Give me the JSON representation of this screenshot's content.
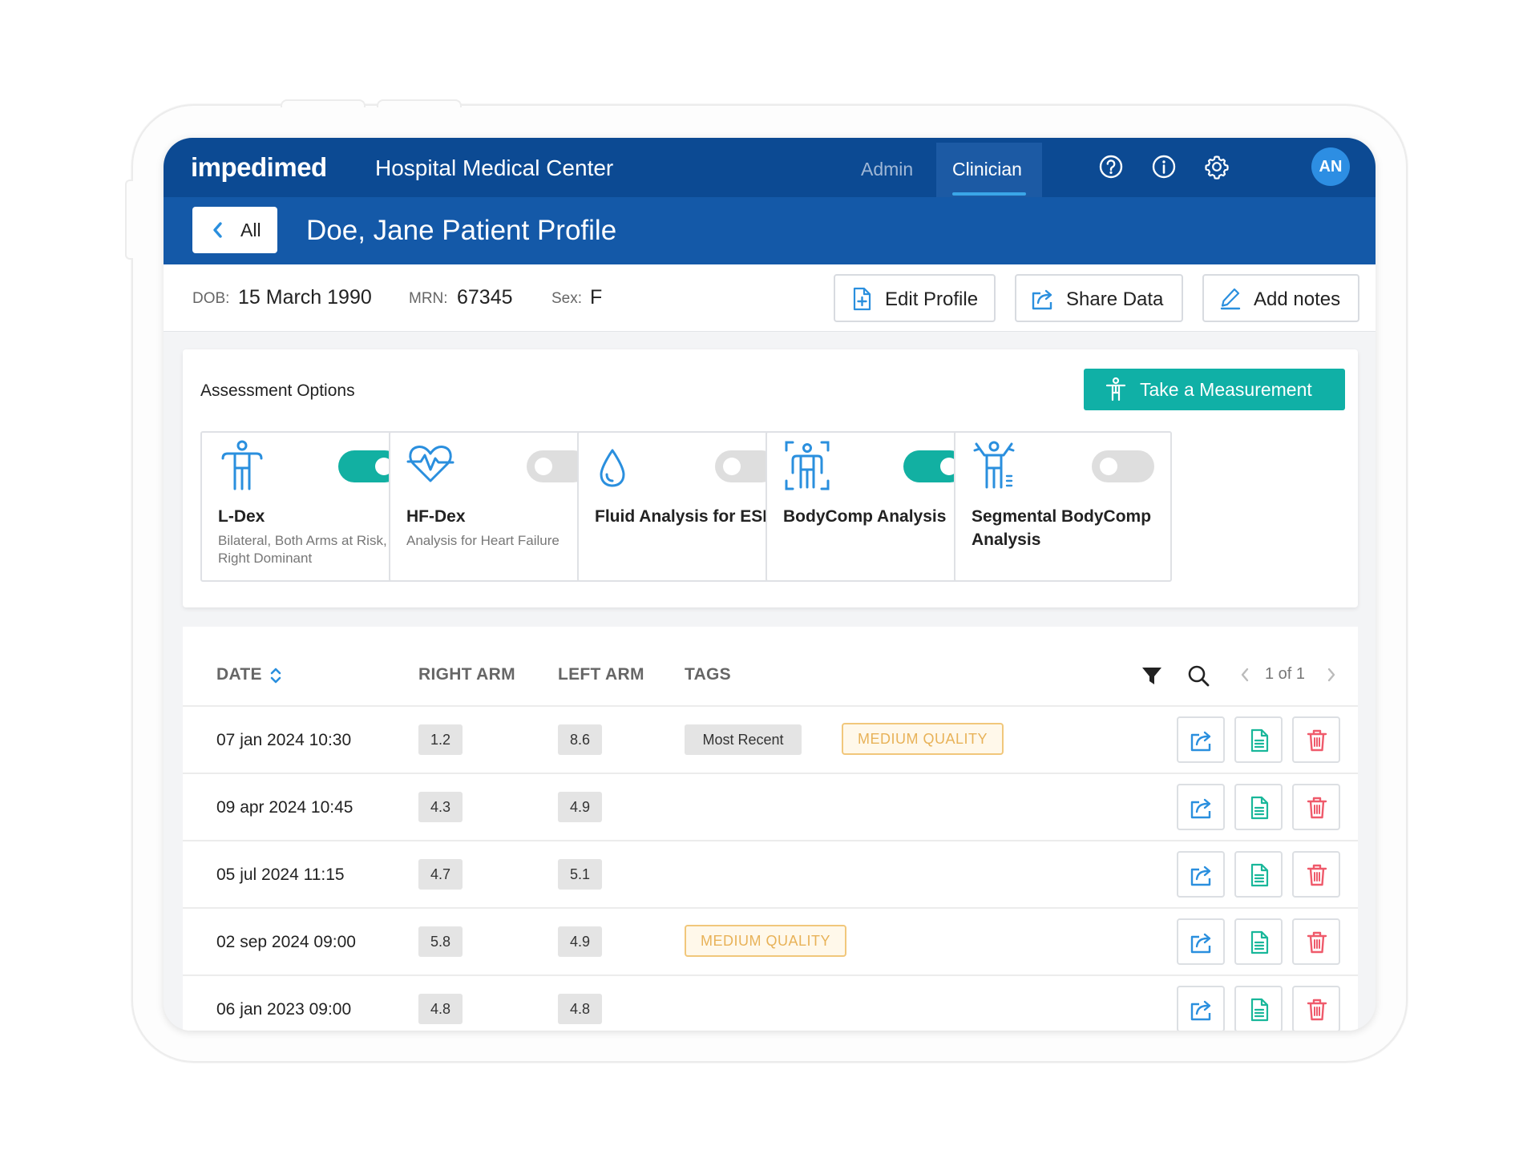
{
  "app": {
    "logo": "impedimed",
    "hospital": "Hospital Medical Center",
    "nav": {
      "admin": "Admin",
      "clinician": "Clinician"
    },
    "icons": [
      "help-icon",
      "info-icon",
      "settings-icon"
    ],
    "avatar": "AN"
  },
  "header": {
    "back_label": "All",
    "title": "Doe, Jane Patient Profile"
  },
  "patient": {
    "dob_label": "DOB:",
    "dob": "15 March 1990",
    "mrn_label": "MRN:",
    "mrn": "67345",
    "sex_label": "Sex:",
    "sex": "F"
  },
  "actions": {
    "edit": "Edit Profile",
    "share": "Share Data",
    "notes": "Add notes"
  },
  "assessment": {
    "title": "Assessment Options",
    "take_measurement": "Take a Measurement",
    "cards": [
      {
        "title": "L-Dex",
        "subtitle": "Bilateral, Both Arms at Risk, Right Dominant",
        "enabled": true,
        "icon": "body-arms-out-icon"
      },
      {
        "title": "HF-Dex",
        "subtitle": "Analysis for Heart Failure",
        "enabled": false,
        "icon": "heart-pulse-icon"
      },
      {
        "title": "Fluid Analysis for ESRD",
        "subtitle": "",
        "enabled": false,
        "icon": "droplet-icon"
      },
      {
        "title": "BodyComp Analysis",
        "subtitle": "",
        "enabled": true,
        "icon": "body-scan-icon"
      },
      {
        "title": "Segmental BodyComp Analysis",
        "subtitle": "",
        "enabled": false,
        "icon": "body-segmental-icon"
      }
    ]
  },
  "table": {
    "headers": {
      "date": "DATE",
      "right_arm": "RIGHT ARM",
      "left_arm": "LEFT ARM",
      "tags": "TAGS"
    },
    "pager": "1 of 1",
    "rows": [
      {
        "date": "07 jan 2024 10:30",
        "right": "1.2",
        "left": "8.6",
        "tags": [
          "Most Recent",
          "MEDIUM QUALITY"
        ]
      },
      {
        "date": "09 apr 2024 10:45",
        "right": "4.3",
        "left": "4.9",
        "tags": []
      },
      {
        "date": "05 jul 2024 11:15",
        "right": "4.7",
        "left": "5.1",
        "tags": []
      },
      {
        "date": "02 sep 2024 09:00",
        "right": "5.8",
        "left": "4.9",
        "tags": [
          "MEDIUM QUALITY"
        ]
      },
      {
        "date": "06 jan 2023 09:00",
        "right": "4.8",
        "left": "4.8",
        "tags": []
      }
    ]
  },
  "colors": {
    "topbar": "#0c4a93",
    "titlebar": "#1459a8",
    "teal": "#10b0a6",
    "share_blue": "#2a8fde",
    "doc_green": "#19b79a",
    "delete_red": "#ef5a6b",
    "quality_amber": "#e8b258"
  }
}
